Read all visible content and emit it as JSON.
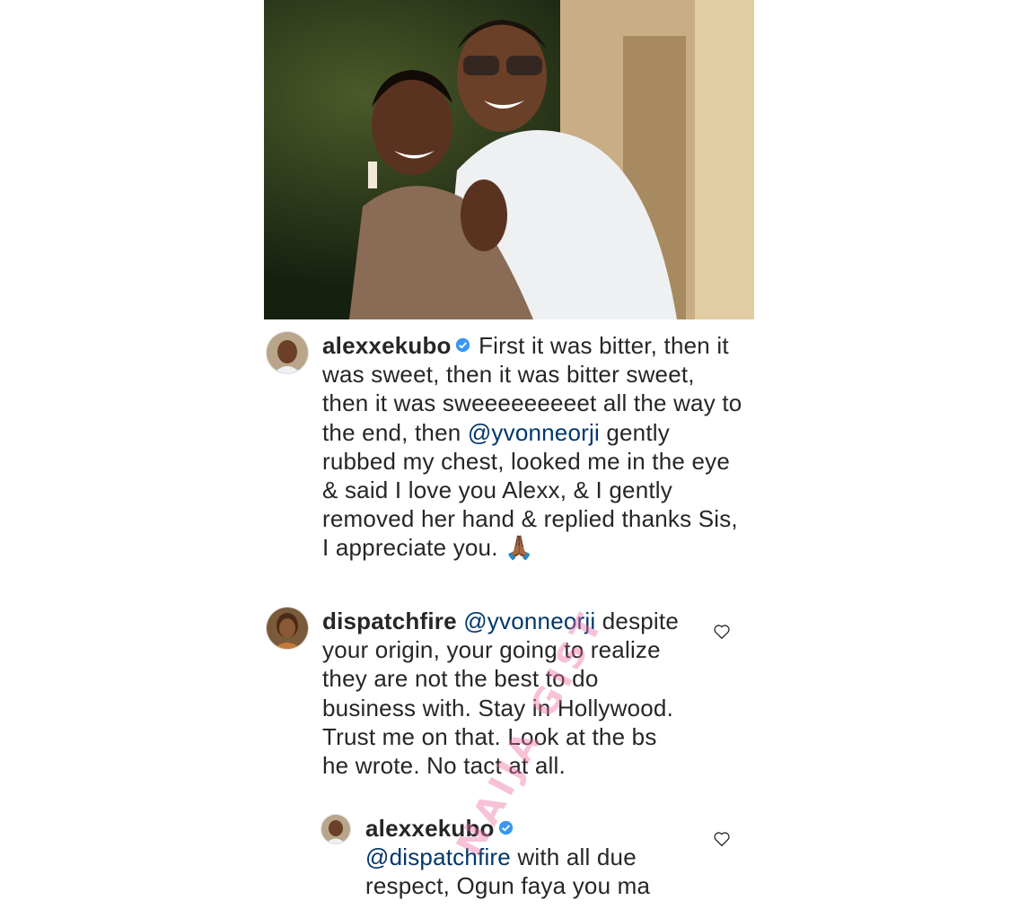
{
  "post": {
    "image_alt": "Couple smiling photo",
    "colors": {
      "accent_link": "#00376b",
      "verified_blue": "#3897f0",
      "text": "#262626"
    }
  },
  "comments": [
    {
      "username": "alexxekubo",
      "verified": true,
      "text_part1": " First it was bitter, then it was sweet, then it was bitter sweet, then it was sweeeeeeeeet all the way to the end, then ",
      "mention": "@yvonneorji",
      "text_part2": " gently rubbed my chest, looked me in the eye & said I love you Alexx, & I gently removed her hand & replied thanks Sis, I appreciate you. ",
      "emoji": "🙏🏾"
    },
    {
      "username": "dispatchfire",
      "verified": false,
      "mention": "@yvonneorji",
      "text": " despite your origin, your going to realize they are not the best to do business with.  Stay in Hollywood.  Trust me on that. Look at the bs he wrote.  No tact at all."
    },
    {
      "username": "alexxekubo",
      "verified": true,
      "mention": "@dispatchfire",
      "text": " with all due respect, Ogun faya you ma"
    }
  ],
  "watermark": "NAIJA GIST",
  "icons": {
    "heart": "heart-outline-icon",
    "verified": "verified-badge-icon"
  }
}
